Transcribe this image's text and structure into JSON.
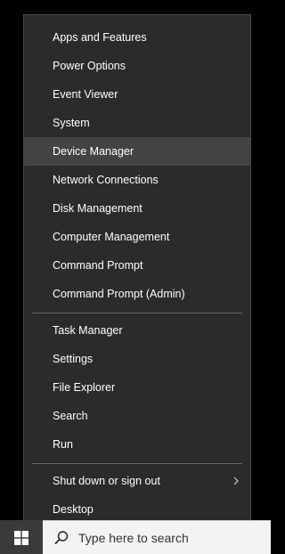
{
  "menu": {
    "group1": [
      {
        "label": "Apps and Features"
      },
      {
        "label": "Power Options"
      },
      {
        "label": "Event Viewer"
      },
      {
        "label": "System"
      },
      {
        "label": "Device Manager",
        "hovered": true
      },
      {
        "label": "Network Connections"
      },
      {
        "label": "Disk Management"
      },
      {
        "label": "Computer Management"
      },
      {
        "label": "Command Prompt"
      },
      {
        "label": "Command Prompt (Admin)"
      }
    ],
    "group2": [
      {
        "label": "Task Manager"
      },
      {
        "label": "Settings"
      },
      {
        "label": "File Explorer"
      },
      {
        "label": "Search"
      },
      {
        "label": "Run"
      }
    ],
    "group3": [
      {
        "label": "Shut down or sign out",
        "has_submenu": true,
        "icon": "chevron-right-icon"
      },
      {
        "label": "Desktop"
      }
    ]
  },
  "taskbar": {
    "start_icon": "windows-logo-icon",
    "search_icon": "search-icon",
    "search_placeholder": "Type here to search"
  },
  "colors": {
    "menu_bg": "#2b2b2b",
    "menu_hover": "#434343",
    "menu_text": "#ffffff",
    "separator": "#6a6a6a",
    "taskbar_bg": "#000000",
    "search_bg": "#f3f3f3"
  }
}
